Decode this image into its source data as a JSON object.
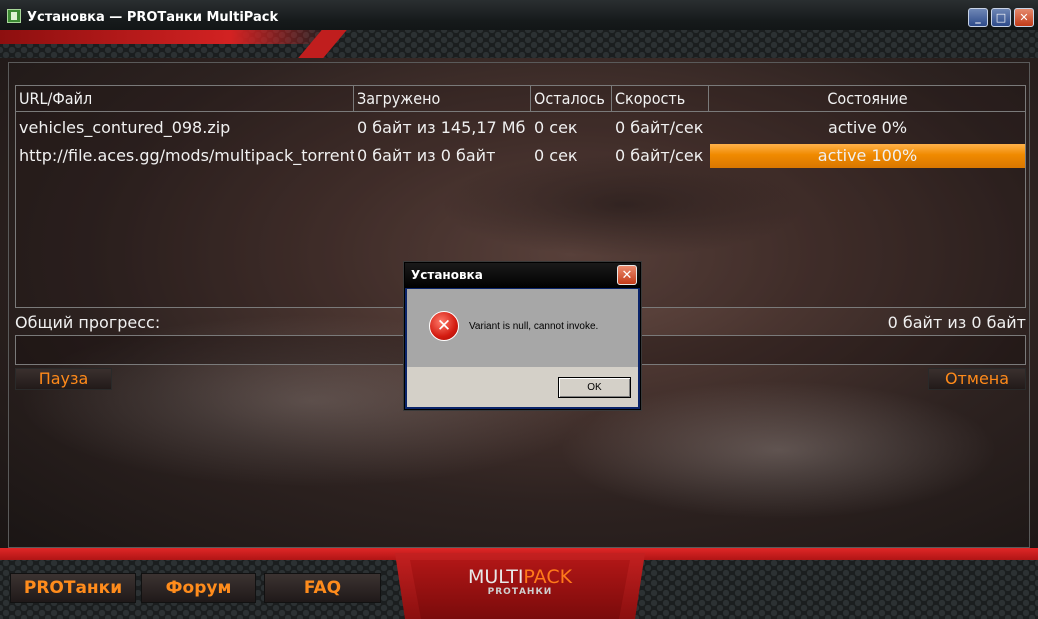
{
  "window": {
    "title": "Установка — PROТанки MultiPack",
    "minimize_label": "_",
    "maximize_label": "□",
    "close_label": "✕"
  },
  "table": {
    "headers": [
      "URL/Файл",
      "Загружено",
      "Осталось",
      "Скорость",
      "Состояние"
    ],
    "rows": [
      {
        "file": "vehicles_contured_098.zip",
        "downloaded": "0 байт из 145,17 Мб",
        "remaining": "0 сек",
        "speed": "0 байт/сек",
        "state": "active 0%",
        "progress": 0
      },
      {
        "file": "http://file.aces.gg/mods/multipack_torrent...",
        "downloaded": "0 байт из 0 байт",
        "remaining": "0 сек",
        "speed": "0 байт/сек",
        "state": "active 100%",
        "progress": 100
      }
    ]
  },
  "overall": {
    "label": "Общий прогресс:",
    "value": "0 байт из 0 байт",
    "progress": 0
  },
  "controls": {
    "pause_label": "Пауза",
    "cancel_label": "Отмена"
  },
  "footer": {
    "links": [
      "PROТанки",
      "Форум",
      "FAQ"
    ],
    "logo_main_left": "MULTI",
    "logo_main_right": "PACK",
    "logo_sub": "PROТАНКИ"
  },
  "dialog": {
    "title": "Установка",
    "close_label": "✕",
    "icon": "error-icon",
    "message": "Variant is null, cannot invoke.",
    "ok_label": "OK"
  },
  "colors": {
    "accent": "#f08a00",
    "brand_red": "#c01e1e",
    "link_orange": "#ff8c1c"
  }
}
